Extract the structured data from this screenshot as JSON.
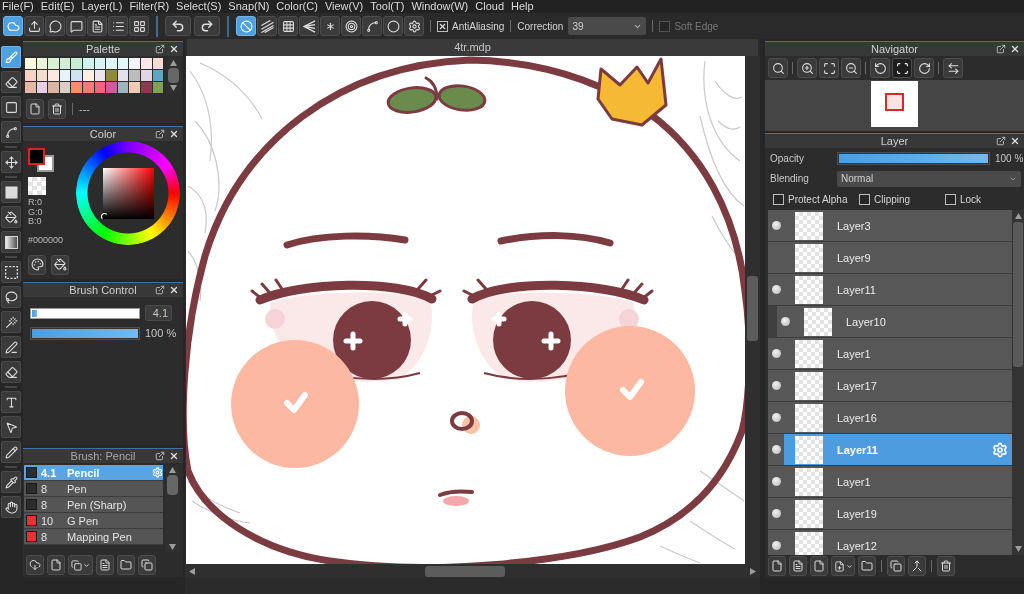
{
  "menu_bar": [
    "File(F)",
    "Edit(E)",
    "Layer(L)",
    "Filter(R)",
    "Select(S)",
    "Snap(N)",
    "Color(C)",
    "View(V)",
    "Tool(T)",
    "Window(W)",
    "Cloud",
    "Help"
  ],
  "toolbar": {
    "snap_buttons": [
      {
        "selected": true
      },
      {
        "selected": false
      },
      {
        "selected": false
      },
      {
        "selected": false
      },
      {
        "selected": false
      },
      {
        "selected": false
      },
      {
        "selected": false
      },
      {
        "selected": false
      },
      {
        "selected": false
      }
    ],
    "antialiasing": {
      "label": "AntiAliasing",
      "checked": true
    },
    "correction": {
      "label": "Correction",
      "value": "39"
    },
    "soft_edge": {
      "label": "Soft Edge",
      "checked": false,
      "disabled": true
    }
  },
  "tools": [
    {
      "selected": true
    },
    {
      "selected": false
    },
    {
      "selected": false
    },
    {
      "selected": false
    },
    {
      "selected": false
    },
    {
      "selected": false
    },
    {
      "selected": false
    },
    {
      "selected": false
    },
    {
      "selected": false
    },
    {
      "selected": false
    },
    {
      "selected": false
    },
    {
      "selected": false
    },
    {
      "selected": false
    },
    {
      "selected": false
    },
    {
      "selected": false
    },
    {
      "selected": false
    },
    {
      "selected": false
    },
    {
      "selected": false
    }
  ],
  "palette_panel": {
    "title": "Palette",
    "swatches": [
      {
        "color": "#fbfbe0"
      },
      {
        "color": "#e9f5d8"
      },
      {
        "color": "#d9f0d5"
      },
      {
        "color": "#d2ecd6"
      },
      {
        "color": "#c6eed6"
      },
      {
        "color": "#cff3ea"
      },
      {
        "color": "#d6f4f3"
      },
      {
        "color": "#ddf6f7"
      },
      {
        "color": "#e4f7f8"
      },
      {
        "color": "#f3f5fb"
      },
      {
        "color": "#fbe6ea"
      },
      {
        "color": "#fad9d9"
      },
      {
        "color": "#fad2c6"
      },
      {
        "color": "#f4ddce"
      },
      {
        "color": "#fbe8e1"
      },
      {
        "color": "#e5f2f6"
      },
      {
        "color": "#cfe2f1"
      },
      {
        "color": "#fdeedf"
      },
      {
        "color": "#ebe3f2"
      },
      {
        "color": "#8d8a3b"
      },
      {
        "color": "#e3e1ef"
      },
      {
        "color": "#bdbdbd"
      },
      {
        "color": "#dfd5e4"
      },
      {
        "color": "#5fa6c6"
      },
      {
        "color": "#e8b7a7"
      },
      {
        "color": "#e6cfe6"
      },
      {
        "color": "#dcb6a4"
      },
      {
        "color": "#d8cec4"
      },
      {
        "color": "#fb8d6e"
      },
      {
        "color": "#f17b79"
      },
      {
        "color": "#ef657a"
      },
      {
        "color": "#cf5c9f"
      },
      {
        "color": "#9ab6bc"
      },
      {
        "color": "#f6cab2"
      },
      {
        "color": "#8a3a4d"
      },
      {
        "color": "#7da357"
      }
    ],
    "set_name": "---"
  },
  "color_panel": {
    "title": "Color",
    "color_slots": [
      {
        "kind": "foreground",
        "color": "#000000",
        "selected": true
      },
      {
        "kind": "background",
        "color": "#ffffff",
        "selected": false
      }
    ],
    "values": [
      "R:0",
      "G:0",
      "B:0"
    ],
    "hex": "#000000"
  },
  "brush_control": {
    "title": "Brush Control",
    "size": {
      "level": 0.05,
      "value": "4.1"
    },
    "opacity": {
      "level": 1,
      "value": "100 %"
    }
  },
  "brush_panel": {
    "title": "Brush: Pencil",
    "brushes": [
      {
        "color": "#22303d",
        "size": "4.1",
        "name": "Pencil",
        "selected": true
      },
      {
        "color": "#2c2c2c",
        "size": "8",
        "name": "Pen",
        "selected": false
      },
      {
        "color": "#2c2c2c",
        "size": "8",
        "name": "Pen (Sharp)",
        "selected": false
      },
      {
        "color": "#ee3030",
        "size": "10",
        "name": "G Pen",
        "selected": false
      },
      {
        "color": "#ee3030",
        "size": "8",
        "name": "Mapping Pen",
        "selected": false
      }
    ]
  },
  "canvas": {
    "tab": "4tr.mdp"
  },
  "navigator": {
    "title": "Navigator",
    "buttons": [
      {
        "selected": false
      },
      {
        "selected": false
      },
      {
        "selected": false
      },
      {
        "selected": false
      },
      {
        "selected": false
      },
      {
        "selected": true
      },
      {
        "selected": false
      },
      {
        "selected": false
      }
    ]
  },
  "layer_panel": {
    "title": "Layer",
    "opacity": {
      "label": "Opacity",
      "level": 1,
      "value": "100 %"
    },
    "blending": {
      "label": "Blending",
      "value": "Normal"
    },
    "options": [
      {
        "label": "Protect Alpha",
        "checked": false
      },
      {
        "label": "Clipping",
        "checked": false
      },
      {
        "label": "Lock",
        "checked": false
      }
    ],
    "layers": [
      {
        "name": "Layer3",
        "visible": true,
        "clipped": false,
        "selected": false
      },
      {
        "name": "Layer9",
        "visible": false,
        "clipped": false,
        "selected": false
      },
      {
        "name": "Layer11",
        "visible": true,
        "clipped": false,
        "selected": false
      },
      {
        "name": "Layer10",
        "visible": true,
        "clipped": true,
        "selected": false
      },
      {
        "name": "Layer1",
        "visible": true,
        "clipped": false,
        "selected": false
      },
      {
        "name": "Layer17",
        "visible": true,
        "clipped": false,
        "selected": false
      },
      {
        "name": "Layer16",
        "visible": true,
        "clipped": false,
        "selected": false
      },
      {
        "name": "Layer11",
        "visible": true,
        "clipped": false,
        "selected": true
      },
      {
        "name": "Layer1",
        "visible": true,
        "clipped": false,
        "selected": false
      },
      {
        "name": "Layer19",
        "visible": true,
        "clipped": false,
        "selected": false
      },
      {
        "name": "Layer12",
        "visible": true,
        "clipped": false,
        "selected": false
      }
    ]
  }
}
